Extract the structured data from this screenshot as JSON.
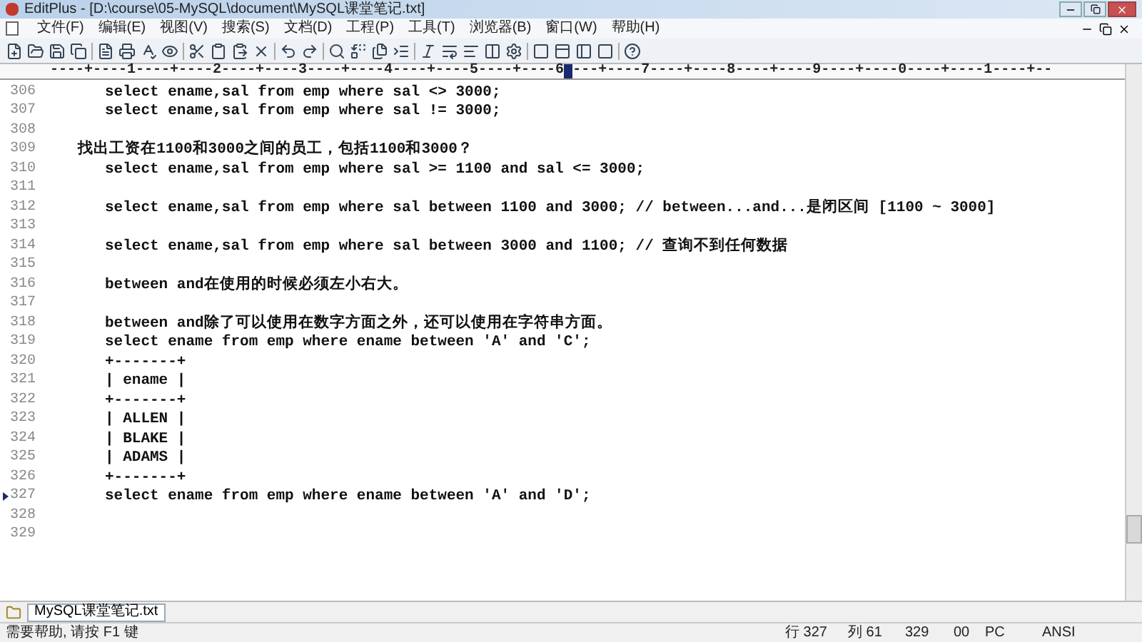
{
  "window": {
    "title": "EditPlus - [D:\\course\\05-MySQL\\document\\MySQL课堂笔记.txt]"
  },
  "menu": [
    "文件(F)",
    "编辑(E)",
    "视图(V)",
    "搜索(S)",
    "文档(D)",
    "工程(P)",
    "工具(T)",
    "浏览器(B)",
    "窗口(W)",
    "帮助(H)"
  ],
  "ruler": [
    "----+----1----+----2----+----3----+----4----+----5----+----6",
    "---+----7----+----8----+----9----+----0----+----1----+--"
  ],
  "lines": [
    {
      "number": "306",
      "text": "     select ename,sal from emp where sal <> 3000;",
      "current": false
    },
    {
      "number": "307",
      "text": "     select ename,sal from emp where sal != 3000;",
      "current": false
    },
    {
      "number": "308",
      "current": false
    },
    {
      "number": "309",
      "text": "  找出工资在1100和3000之间的员工，包括1100和3000？",
      "current": false
    },
    {
      "number": "310",
      "text": "     select ename,sal from emp where sal >= 1100 and sal <= 3000;",
      "current": false
    },
    {
      "number": "311",
      "current": false
    },
    {
      "number": "312",
      "text": "     select ename,sal from emp where sal between 1100 and 3000; // between...and...是闭区间 [1100 ~ 3000]",
      "current": false
    },
    {
      "number": "313",
      "current": false
    },
    {
      "number": "314",
      "text": "     select ename,sal from emp where sal between 3000 and 1100; // 查询不到任何数据",
      "current": false
    },
    {
      "number": "315",
      "current": false
    },
    {
      "number": "316",
      "text": "     between and在使用的时候必须左小右大。",
      "current": false
    },
    {
      "number": "317",
      "current": false
    },
    {
      "number": "318",
      "text": "     between and除了可以使用在数字方面之外，还可以使用在字符串方面。",
      "current": false
    },
    {
      "number": "319",
      "text": "     select ename from emp where ename between 'A' and 'C';",
      "current": false
    },
    {
      "number": "320",
      "text": "     +-------+",
      "current": false
    },
    {
      "number": "321",
      "text": "     | ename |",
      "current": false
    },
    {
      "number": "322",
      "text": "     +-------+",
      "current": false
    },
    {
      "number": "323",
      "text": "     | ALLEN |",
      "current": false
    },
    {
      "number": "324",
      "text": "     | BLAKE |",
      "current": false
    },
    {
      "number": "325",
      "text": "     | ADAMS |",
      "current": false
    },
    {
      "number": "326",
      "text": "     +-------+",
      "current": false
    },
    {
      "number": "327",
      "text": "     select ename from emp where ename between 'A' and 'D';",
      "current": true
    },
    {
      "number": "328",
      "current": false
    },
    {
      "number": "329",
      "current": false
    }
  ],
  "file_tabs": [
    {
      "label": "MySQL课堂笔记.txt",
      "selected": true
    }
  ],
  "status_bar": {
    "help": "需要帮助, 请按 F1 键",
    "row": "行 327",
    "col": "列 61",
    "lines": "329",
    "code": "00",
    "mode": "PC",
    "encoding": "ANSI"
  }
}
